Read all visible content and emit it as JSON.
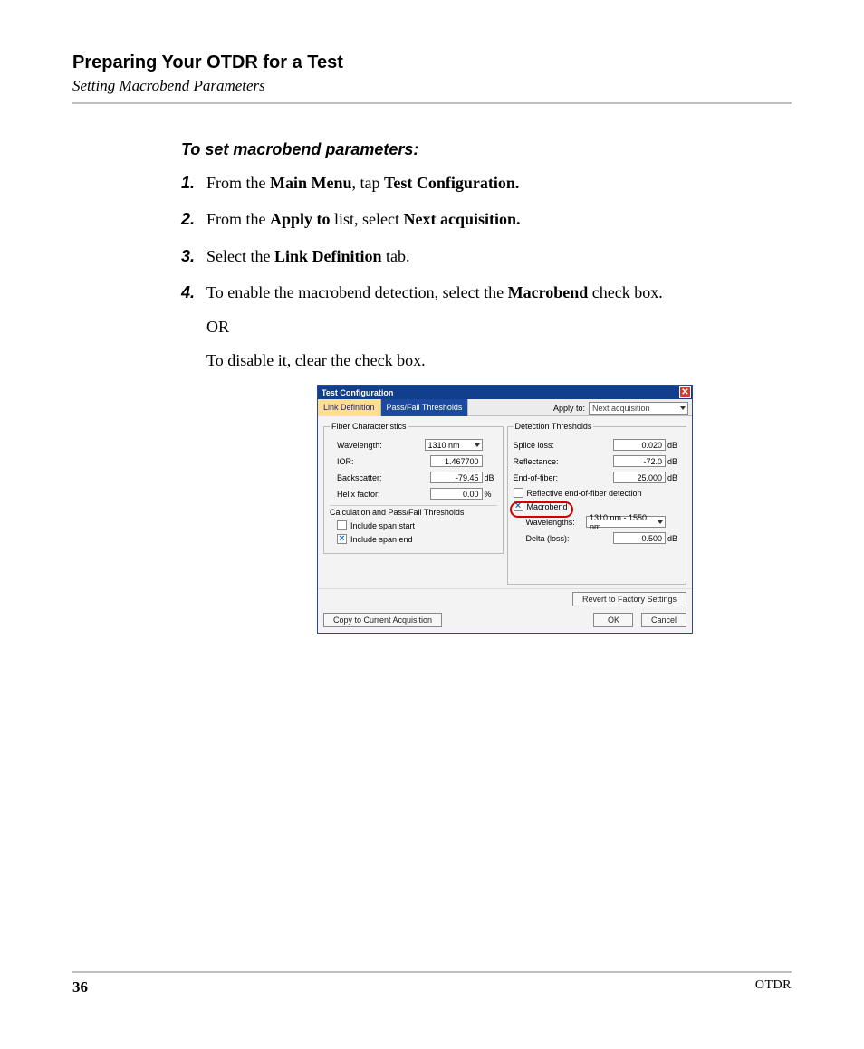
{
  "header": {
    "title": "Preparing Your OTDR for a Test",
    "subtitle": "Setting Macrobend Parameters"
  },
  "instructions": {
    "heading": "To set macrobend parameters:",
    "steps": {
      "1": {
        "pre": "From the ",
        "b1": "Main Menu",
        "mid": ", tap ",
        "b2": "Test Configuration."
      },
      "2": {
        "pre": "From the ",
        "b1": "Apply to",
        "mid": " list, select ",
        "b2": "Next acquisition."
      },
      "3": {
        "pre": "Select the ",
        "b1": "Link Definition",
        "mid": " tab."
      },
      "4": {
        "pre": "To enable the macrobend detection, select the ",
        "b1": "Macrobend",
        "mid": " check box."
      },
      "4or": "OR",
      "4b": "To disable it, clear the check box."
    }
  },
  "dialog": {
    "title": "Test Configuration",
    "close": "✕",
    "tabs": {
      "active": "Link Definition",
      "inactive": "Pass/Fail Thresholds"
    },
    "apply_to": {
      "label": "Apply to:",
      "value": "Next acquisition"
    },
    "fiber_group": {
      "legend": "Fiber Characteristics",
      "wavelength": {
        "label": "Wavelength:",
        "value": "1310 nm"
      },
      "ior": {
        "label": "IOR:",
        "value": "1.467700"
      },
      "backscatter": {
        "label": "Backscatter:",
        "value": "-79.45",
        "unit": "dB"
      },
      "helix": {
        "label": "Helix factor:",
        "value": "0.00",
        "unit": "%"
      },
      "calc_legend": "Calculation and Pass/Fail Thresholds",
      "span_start": "Include span start",
      "span_end": "Include span end"
    },
    "detect_group": {
      "legend": "Detection Thresholds",
      "splice": {
        "label": "Splice loss:",
        "value": "0.020",
        "unit": "dB"
      },
      "reflect": {
        "label": "Reflectance:",
        "value": "-72.0",
        "unit": "dB"
      },
      "eof": {
        "label": "End-of-fiber:",
        "value": "25.000",
        "unit": "dB"
      },
      "reflective_eof": "Reflective end-of-fiber detection",
      "macrobend": "Macrobend",
      "wavelengths": {
        "label": "Wavelengths:",
        "value": "1310 nm - 1550 nm"
      },
      "delta": {
        "label": "Delta (loss):",
        "value": "0.500",
        "unit": "dB"
      }
    },
    "buttons": {
      "revert": "Revert to Factory Settings",
      "copy": "Copy to Current Acquisition",
      "ok": "OK",
      "cancel": "Cancel"
    }
  },
  "footer": {
    "page": "36",
    "product": "OTDR"
  }
}
